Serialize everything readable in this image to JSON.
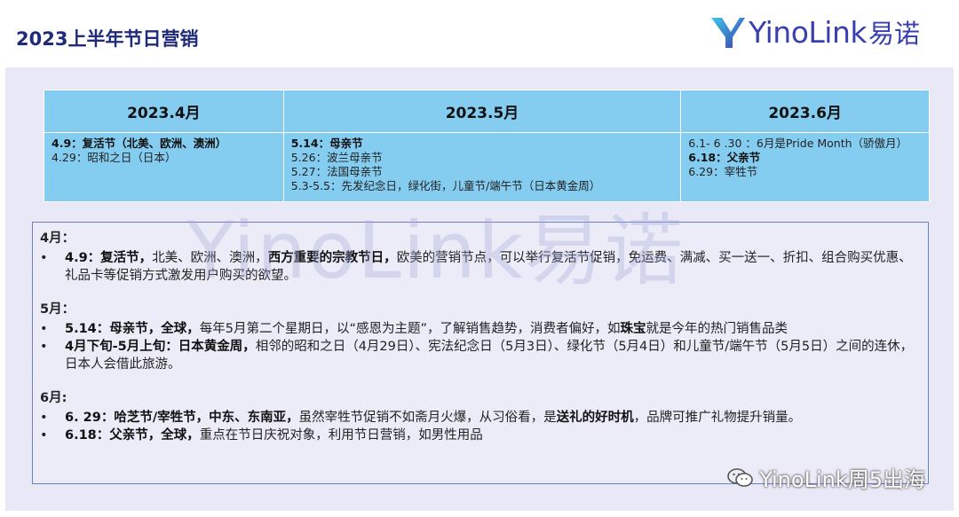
{
  "header": {
    "title": "2023上半年节日营销",
    "logo_text": "YinoLink",
    "logo_cn": "易诺"
  },
  "table": {
    "headers": [
      "2023.4月",
      "2023.5月",
      "2023.6月"
    ],
    "columns": [
      [
        {
          "text": "4.9：复活节（北美、欧洲、澳洲）",
          "bold": true
        },
        {
          "text": "4.29：昭和之日（日本）",
          "bold": false
        }
      ],
      [
        {
          "text": "5.14：母亲节",
          "bold": true
        },
        {
          "text": "5.26：波兰母亲节",
          "bold": false
        },
        {
          "text": "5.27：法国母亲节",
          "bold": false
        },
        {
          "text": "5.3-5.5：先发纪念日，绿化街，儿童节/端午节（日本黄金周）",
          "bold": false
        }
      ],
      [
        {
          "text": "6.1- 6 .30 ：6月是Pride Month（骄傲月）",
          "bold": false
        },
        {
          "text": "6.18：父亲节",
          "bold": true
        },
        {
          "text": "6.29：宰牲节",
          "bold": false
        }
      ]
    ]
  },
  "notes": {
    "april": {
      "heading": "4月：",
      "items": [
        [
          {
            "t": "4.9：复活节，",
            "b": true
          },
          {
            "t": "北美、欧洲、澳洲，",
            "b": false
          },
          {
            "t": "西方重要的宗教节日，",
            "b": true
          },
          {
            "t": "欧美的营销节点，可以举行复活节促销，免运费、满减、买一送一、折扣、组合购买优惠、礼品卡等促销方式激发用户购买的欲望。",
            "b": false
          }
        ]
      ]
    },
    "may": {
      "heading": "5月：",
      "items": [
        [
          {
            "t": "5.14：母亲节，全球，",
            "b": true
          },
          {
            "t": "每年5月第二个星期日，以“感恩为主题”，了解销售趋势，消费者偏好，如",
            "b": false
          },
          {
            "t": "珠宝",
            "b": true
          },
          {
            "t": "就是今年的热门销售品类",
            "b": false
          }
        ],
        [
          {
            "t": "4月下旬-5月上旬：日本黄金周，",
            "b": true
          },
          {
            "t": "相邻的昭和之日（4月29日）、宪法纪念日（5月3日）、绿化节（5月4日）和儿童节/端午节（5月5日）之间的连休，日本人会借此旅游。",
            "b": false
          }
        ]
      ]
    },
    "june": {
      "heading": "6月:",
      "items": [
        [
          {
            "t": "6. 29：哈芝节/宰牲节，中东、东南亚，",
            "b": true
          },
          {
            "t": "虽然宰牲节促销不如斋月火爆，从习俗看，是",
            "b": false
          },
          {
            "t": "送礼的好时机",
            "b": true
          },
          {
            "t": "，品牌可推广礼物提升销量。",
            "b": false
          }
        ],
        [
          {
            "t": "6.18：父亲节，全球，",
            "b": true
          },
          {
            "t": "重点在节日庆祝对象，利用节日营销，如男性用品",
            "b": false
          }
        ]
      ]
    }
  },
  "watermark": "YinoLink易诺",
  "footer": {
    "wechat_label": "YinoLink周5出海",
    "icon": "wechat-icon"
  },
  "colors": {
    "title": "#1f2a7a",
    "table_fill": "#85cdf0",
    "panel_bg": "#e9e8f7",
    "border": "#6a7fc6"
  }
}
